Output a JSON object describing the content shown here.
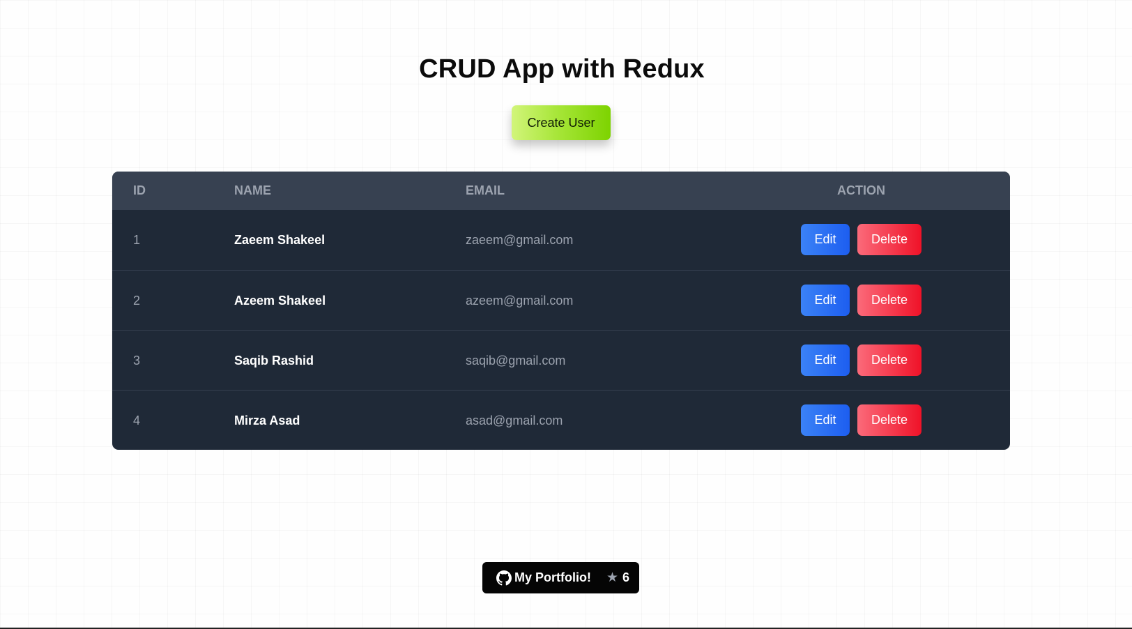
{
  "page": {
    "title": "CRUD App with Redux",
    "create_button_label": "Create User"
  },
  "table": {
    "headers": {
      "id": "ID",
      "name": "NAME",
      "email": "EMAIL",
      "action": "ACTION"
    },
    "rows": [
      {
        "id": "1",
        "name": "Zaeem Shakeel",
        "email": "zaeem@gmail.com",
        "edit_label": "Edit",
        "delete_label": "Delete"
      },
      {
        "id": "2",
        "name": "Azeem Shakeel",
        "email": "azeem@gmail.com",
        "edit_label": "Edit",
        "delete_label": "Delete"
      },
      {
        "id": "3",
        "name": "Saqib Rashid",
        "email": "saqib@gmail.com",
        "edit_label": "Edit",
        "delete_label": "Delete"
      },
      {
        "id": "4",
        "name": "Mirza Asad",
        "email": "asad@gmail.com",
        "edit_label": "Edit",
        "delete_label": "Delete"
      }
    ]
  },
  "footer": {
    "portfolio_label": "My Portfolio!",
    "star_count": "6",
    "icons": {
      "brand": "github-icon",
      "star": "star-icon"
    }
  },
  "colors": {
    "table_body": "#1f2937",
    "table_header": "#374151",
    "edit_button": "#1d5ef0",
    "delete_button": "#ef1228",
    "create_button": "#7dd300"
  }
}
